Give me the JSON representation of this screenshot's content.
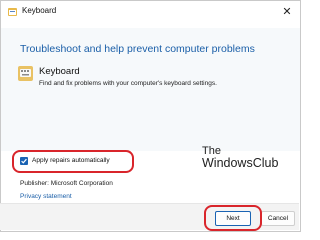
{
  "window": {
    "title": "Keyboard",
    "close_glyph": "✕",
    "icon": "troubleshooter-icon"
  },
  "main": {
    "heading": "Troubleshoot and help prevent computer problems",
    "item": {
      "title": "Keyboard",
      "description": "Find and fix problems with your computer's keyboard settings.",
      "icon": "keyboard-icon"
    }
  },
  "options": {
    "apply_repairs_label": "Apply repairs automatically",
    "apply_repairs_checked": true
  },
  "watermark": {
    "line1": "The",
    "line2": "WindowsClub"
  },
  "info": {
    "publisher": "Publisher:  Microsoft Corporation",
    "privacy_link": "Privacy statement"
  },
  "footer": {
    "next_label": "Next",
    "cancel_label": "Cancel"
  },
  "colors": {
    "accent": "#1a63b3",
    "link": "#1b5fa8",
    "annotation_red": "#d9252b"
  }
}
